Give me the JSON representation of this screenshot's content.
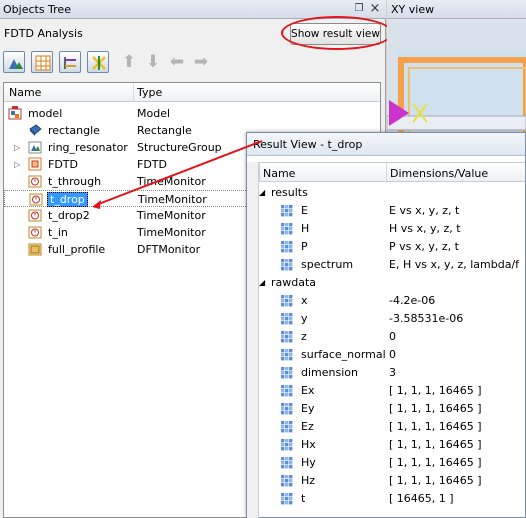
{
  "tree_panel": {
    "title": "Objects Tree",
    "pin_glyph": "❐",
    "close_glyph": "×",
    "analysis_label": "FDTD Analysis",
    "show_result_label": "Show result view",
    "columns": {
      "name": "Name",
      "type": "Type"
    },
    "items": [
      {
        "name": "model",
        "type": "Model",
        "icon": "model-icon"
      },
      {
        "name": "rectangle",
        "type": "Rectangle",
        "icon": "rectangle-icon"
      },
      {
        "name": "ring_resonator",
        "type": "StructureGroup",
        "icon": "structure-group-icon"
      },
      {
        "name": "FDTD",
        "type": "FDTD",
        "icon": "fdtd-icon"
      },
      {
        "name": "t_through",
        "type": "TimeMonitor",
        "icon": "time-monitor-icon"
      },
      {
        "name": "t_drop",
        "type": "TimeMonitor",
        "icon": "time-monitor-icon"
      },
      {
        "name": "t_drop2",
        "type": "TimeMonitor",
        "icon": "time-monitor-icon"
      },
      {
        "name": "t_in",
        "type": "TimeMonitor",
        "icon": "time-monitor-icon"
      },
      {
        "name": "full_profile",
        "type": "DFTMonitor",
        "icon": "dft-monitor-icon"
      }
    ]
  },
  "xy_view": {
    "title": "XY view"
  },
  "result_view": {
    "title": "Result View - t_drop",
    "columns": {
      "name": "Name",
      "value": "Dimensions/Value"
    },
    "results_group": "results",
    "results": [
      {
        "name": "E",
        "value": "E vs x, y, z, t"
      },
      {
        "name": "H",
        "value": "H vs x, y, z, t"
      },
      {
        "name": "P",
        "value": "P vs x, y, z, t"
      },
      {
        "name": "spectrum",
        "value": "E, H vs x, y, z, lambda/f"
      }
    ],
    "rawdata_group": "rawdata",
    "rawdata": [
      {
        "name": "x",
        "value": "-4.2e-06"
      },
      {
        "name": "y",
        "value": "-3.58531e-06"
      },
      {
        "name": "z",
        "value": "0"
      },
      {
        "name": "surface_normal",
        "value": "0"
      },
      {
        "name": "dimension",
        "value": "3"
      },
      {
        "name": "Ex",
        "value": "[ 1, 1, 1, 16465 ]"
      },
      {
        "name": "Ey",
        "value": "[ 1, 1, 1, 16465 ]"
      },
      {
        "name": "Ez",
        "value": "[ 1, 1, 1, 16465 ]"
      },
      {
        "name": "Hx",
        "value": "[ 1, 1, 1, 16465 ]"
      },
      {
        "name": "Hy",
        "value": "[ 1, 1, 1, 16465 ]"
      },
      {
        "name": "Hz",
        "value": "[ 1, 1, 1, 16465 ]"
      },
      {
        "name": "t",
        "value": "[ 16465, 1 ]"
      }
    ]
  },
  "colors": {
    "selection": "#3399ff",
    "annotation": "#e0141a",
    "xy_orange": "#f5a04a",
    "xy_magenta": "#cc33cc"
  }
}
